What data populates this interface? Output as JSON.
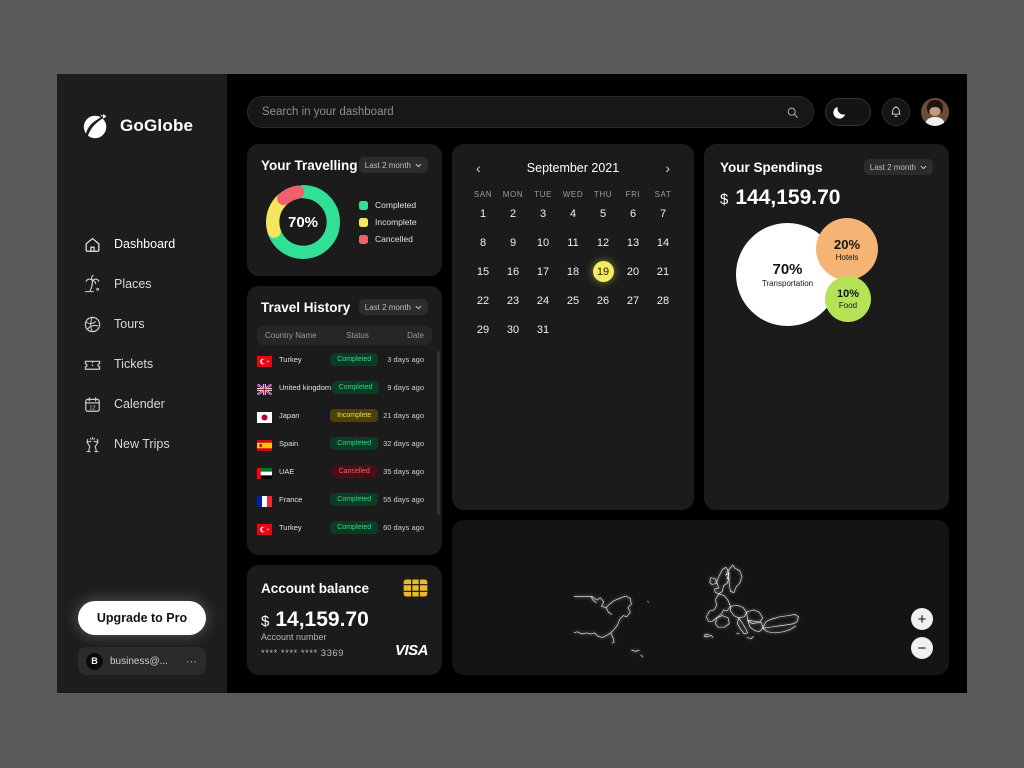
{
  "brand": {
    "name": "GoGlobe",
    "logo_icon": "globe-plane-logo"
  },
  "sidebar": {
    "items": [
      {
        "label": "Dashboard",
        "icon": "home-icon",
        "active": true
      },
      {
        "label": "Places",
        "icon": "palm-tree-icon",
        "active": false
      },
      {
        "label": "Tours",
        "icon": "globe-icon",
        "active": false
      },
      {
        "label": "Tickets",
        "icon": "ticket-icon",
        "active": false
      },
      {
        "label": "Calender",
        "icon": "calendar-icon",
        "active": false
      },
      {
        "label": "New Trips",
        "icon": "cheers-glasses-icon",
        "active": false
      }
    ],
    "upgrade_label": "Upgrade to Pro",
    "account": {
      "initial": "B",
      "email": "business@...",
      "more_icon": "ellipsis-icon"
    }
  },
  "topbar": {
    "search_placeholder": "Search in your dashboard",
    "search_value": "",
    "search_icon": "search-icon",
    "theme_toggle_icon": "moon-icon",
    "notification_icon": "bell-icon",
    "avatar_icon": "user-avatar"
  },
  "travelling": {
    "title": "Your Travelling",
    "range": "Last 2 month",
    "center_value": "70%",
    "chart_data": {
      "type": "pie",
      "title": "Your Travelling",
      "categories": [
        "Completed",
        "Incomplete",
        "Cancelled"
      ],
      "values": [
        70,
        20,
        10
      ],
      "colors": [
        "#2fe096",
        "#f5e65c",
        "#f2606e"
      ],
      "legend_position": "right"
    }
  },
  "history": {
    "title": "Travel History",
    "range": "Last 2 month",
    "columns": [
      "Country Name",
      "Status",
      "Date"
    ],
    "rows": [
      {
        "country": "Turkey",
        "flag": "tr",
        "status": "Completed",
        "status_key": "completed",
        "date": "3 days ago"
      },
      {
        "country": "United kingdom",
        "flag": "gb",
        "status": "Completed",
        "status_key": "completed",
        "date": "9 days ago"
      },
      {
        "country": "Japan",
        "flag": "jp",
        "status": "Incomplete",
        "status_key": "incomplete",
        "date": "21 days ago"
      },
      {
        "country": "Spain",
        "flag": "es",
        "status": "Completed",
        "status_key": "completed",
        "date": "32 days ago"
      },
      {
        "country": "UAE",
        "flag": "ae",
        "status": "Cancelled",
        "status_key": "cancelled",
        "date": "35 days ago"
      },
      {
        "country": "France",
        "flag": "fr",
        "status": "Completed",
        "status_key": "completed",
        "date": "55 days ago"
      },
      {
        "country": "Turkey",
        "flag": "tr",
        "status": "Completed",
        "status_key": "completed",
        "date": "60 days ago"
      }
    ]
  },
  "balance": {
    "title": "Account balance",
    "currency": "$",
    "amount": "14,159.70",
    "account_label": "Account number",
    "account_masked": "**** **** **** 3369",
    "brand": "VISA",
    "chip_icon": "card-chip-icon"
  },
  "calendar": {
    "month": "September 2021",
    "prev_icon": "chevron-left-icon",
    "next_icon": "chevron-right-icon",
    "dow": [
      "SAN",
      "MON",
      "TUE",
      "WED",
      "THU",
      "FRI",
      "SAT"
    ],
    "lead_blanks": 0,
    "days": [
      1,
      2,
      3,
      4,
      5,
      6,
      7,
      8,
      9,
      10,
      11,
      12,
      13,
      14,
      15,
      16,
      17,
      18,
      19,
      20,
      21,
      22,
      23,
      24,
      25,
      26,
      27,
      28,
      29,
      30,
      31
    ],
    "selected_day": 19
  },
  "spendings": {
    "title": "Your Spendings",
    "range": "Last 2 month",
    "currency": "$",
    "amount": "144,159.70",
    "chart_data": {
      "type": "pie",
      "title": "Your Spendings",
      "categories": [
        "Transportation",
        "Hotels",
        "Food"
      ],
      "values": [
        70,
        20,
        10
      ],
      "labels": [
        "70%",
        "20%",
        "10%"
      ],
      "colors": [
        "#ffffff",
        "#f5b473",
        "#b6e356"
      ]
    }
  },
  "map": {
    "zoom_in_label": "+",
    "zoom_out_label": "−",
    "zoom_in_icon": "plus-icon",
    "zoom_out_icon": "minus-icon"
  },
  "colors": {
    "accent_green": "#2fe096",
    "accent_yellow": "#f2ec5e",
    "accent_red": "#f2606e",
    "accent_orange": "#f5b473",
    "card_bg": "#1b1b1b",
    "sidebar_bg": "#1d1d1d"
  }
}
